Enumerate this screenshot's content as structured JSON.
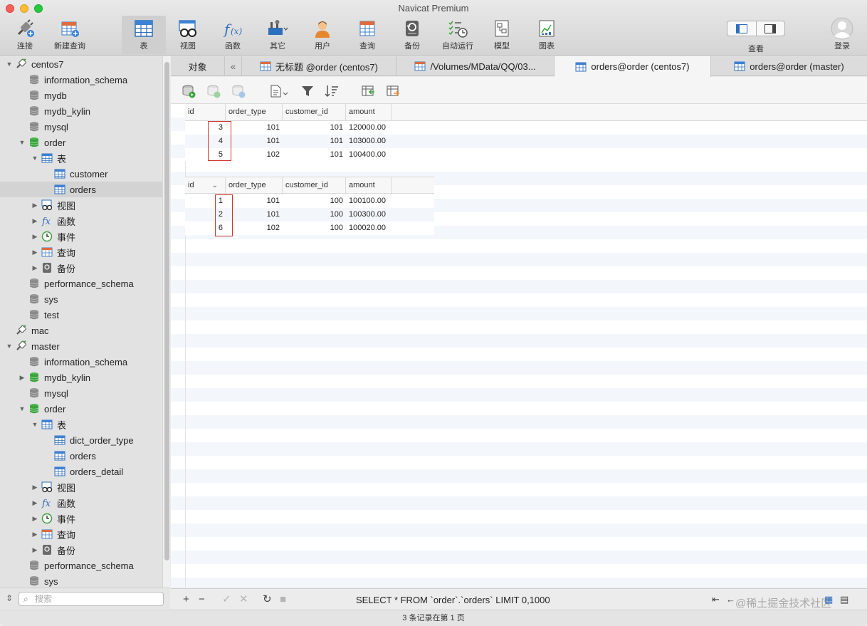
{
  "window": {
    "title": "Navicat Premium"
  },
  "toolbar": {
    "items": [
      {
        "label": "连接",
        "icon": "plug-icon"
      },
      {
        "label": "新建查询",
        "icon": "new-query-icon"
      },
      {
        "label": "表",
        "icon": "table-icon",
        "active": true
      },
      {
        "label": "视图",
        "icon": "view-icon"
      },
      {
        "label": "函数",
        "icon": "function-icon"
      },
      {
        "label": "其它",
        "icon": "tools-icon"
      },
      {
        "label": "用户",
        "icon": "user-icon"
      },
      {
        "label": "查询",
        "icon": "query-icon"
      },
      {
        "label": "备份",
        "icon": "backup-icon"
      },
      {
        "label": "自动运行",
        "icon": "schedule-icon"
      },
      {
        "label": "模型",
        "icon": "model-icon"
      },
      {
        "label": "图表",
        "icon": "chart-icon"
      }
    ],
    "view_label": "查看",
    "login_label": "登录"
  },
  "sidebar": {
    "items": [
      {
        "label": "centos7",
        "type": "connection",
        "expanded": true
      },
      {
        "label": "information_schema",
        "type": "db"
      },
      {
        "label": "mydb",
        "type": "db"
      },
      {
        "label": "mydb_kylin",
        "type": "db"
      },
      {
        "label": "mysql",
        "type": "db"
      },
      {
        "label": "order",
        "type": "db-open",
        "expanded": true
      },
      {
        "label": "表",
        "type": "tables",
        "expanded": true
      },
      {
        "label": "customer",
        "type": "table"
      },
      {
        "label": "orders",
        "type": "table",
        "selected": true
      },
      {
        "label": "视图",
        "type": "views"
      },
      {
        "label": "函数",
        "type": "functions"
      },
      {
        "label": "事件",
        "type": "events"
      },
      {
        "label": "查询",
        "type": "queries"
      },
      {
        "label": "备份",
        "type": "backups"
      },
      {
        "label": "performance_schema",
        "type": "db"
      },
      {
        "label": "sys",
        "type": "db"
      },
      {
        "label": "test",
        "type": "db"
      },
      {
        "label": "mac",
        "type": "connection"
      },
      {
        "label": "master",
        "type": "connection",
        "expanded": true
      },
      {
        "label": "information_schema",
        "type": "db"
      },
      {
        "label": "mydb_kylin",
        "type": "db-open"
      },
      {
        "label": "mysql",
        "type": "db"
      },
      {
        "label": "order",
        "type": "db-open",
        "expanded": true
      },
      {
        "label": "表",
        "type": "tables",
        "expanded": true
      },
      {
        "label": "dict_order_type",
        "type": "table"
      },
      {
        "label": "orders",
        "type": "table"
      },
      {
        "label": "orders_detail",
        "type": "table"
      },
      {
        "label": "视图",
        "type": "views"
      },
      {
        "label": "函数",
        "type": "functions"
      },
      {
        "label": "事件",
        "type": "events"
      },
      {
        "label": "查询",
        "type": "queries"
      },
      {
        "label": "备份",
        "type": "backups"
      },
      {
        "label": "performance_schema",
        "type": "db"
      },
      {
        "label": "sys",
        "type": "db"
      }
    ],
    "search_placeholder": "搜索"
  },
  "tabs": {
    "objects_label": "对象",
    "collapse_label": "«",
    "items": [
      {
        "label": "无标题 @order (centos7)",
        "active": false
      },
      {
        "label": "/Volumes/MData/QQ/03...",
        "active": false
      },
      {
        "label": "orders@order (centos7)",
        "active": true
      },
      {
        "label": "orders@order (master)",
        "active": false
      }
    ]
  },
  "grid1": {
    "columns": [
      "id",
      "order_type",
      "customer_id",
      "amount"
    ],
    "rows": [
      [
        "3",
        "101",
        "101",
        "120000.00"
      ],
      [
        "4",
        "101",
        "101",
        "103000.00"
      ],
      [
        "5",
        "102",
        "101",
        "100400.00"
      ]
    ]
  },
  "grid2": {
    "columns": [
      "id",
      "order_type",
      "customer_id",
      "amount"
    ],
    "rows": [
      [
        "1",
        "101",
        "100",
        "100100.00"
      ],
      [
        "2",
        "101",
        "100",
        "100300.00"
      ],
      [
        "6",
        "102",
        "100",
        "100020.00"
      ]
    ]
  },
  "bottom": {
    "sql": "SELECT * FROM `order`.`orders` LIMIT 0,1000",
    "watermark": "@稀土掘金技术社区",
    "status": "3 条记录在第 1 页"
  },
  "colors": {
    "highlight_box": "#d0342c",
    "db_green": "#3aa33a"
  }
}
